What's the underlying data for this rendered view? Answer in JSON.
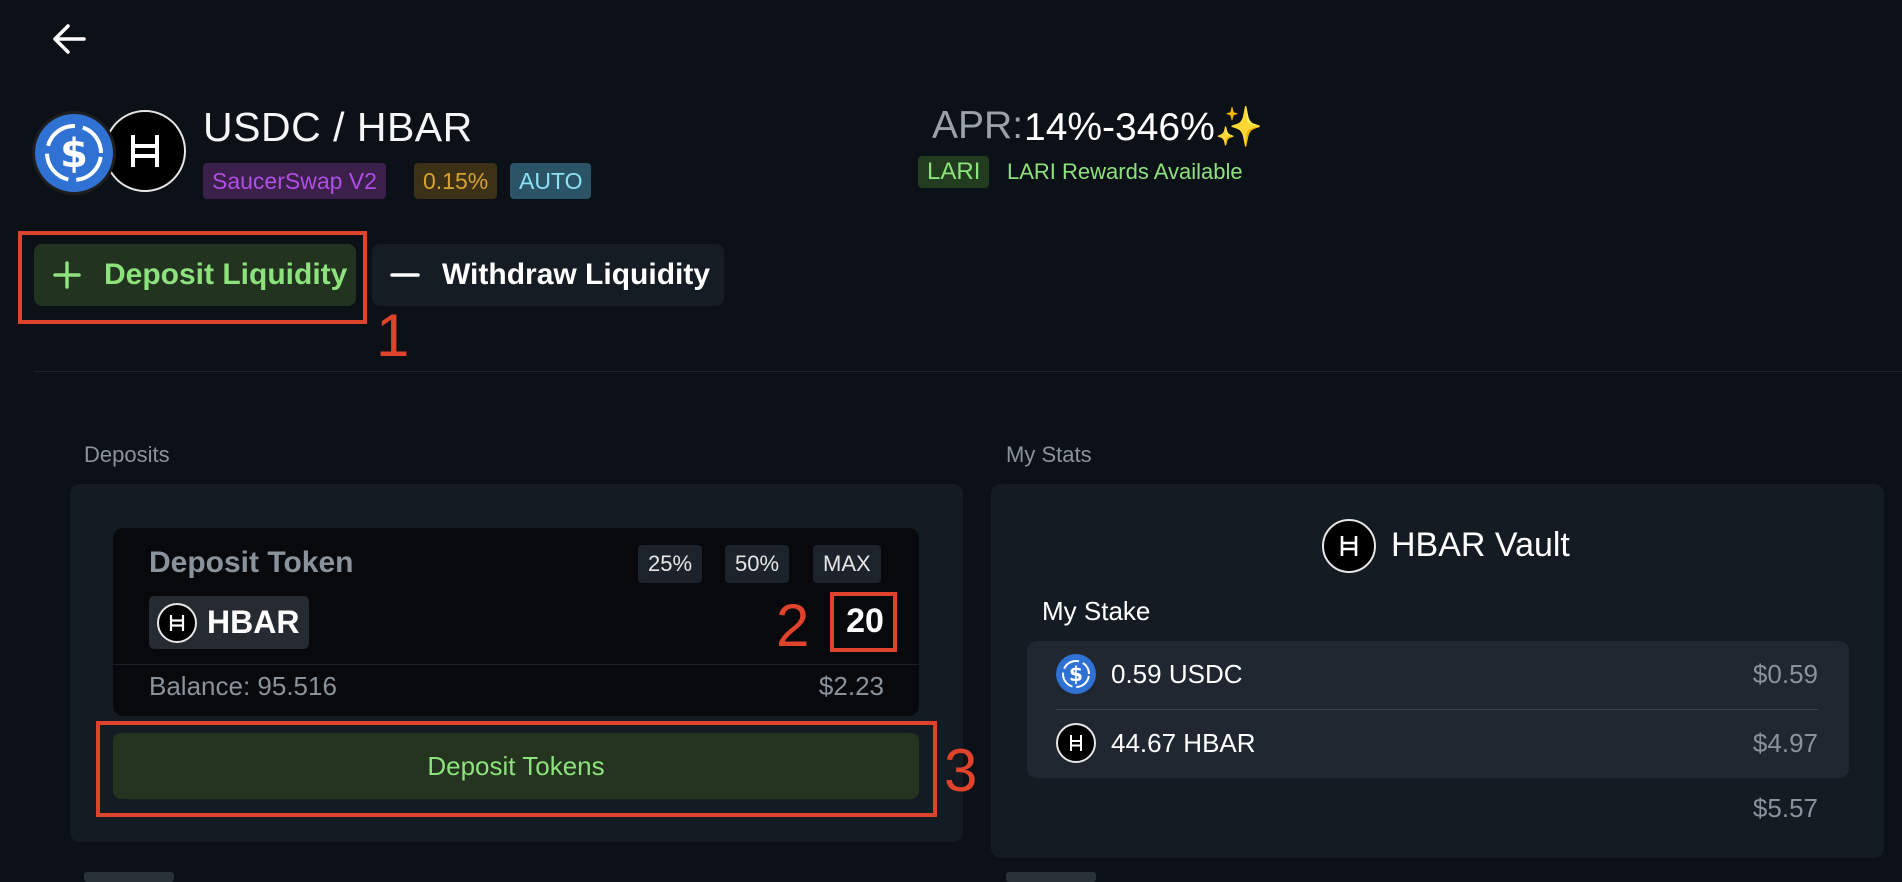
{
  "header": {
    "pair_title": "USDC / HBAR",
    "badges": {
      "dex": "SaucerSwap V2",
      "fee": "0.15%",
      "mode": "AUTO"
    },
    "apr": {
      "label": "APR:",
      "value": "14%-346%✨"
    },
    "rewards": {
      "badge": "LARI",
      "text": "LARI Rewards Available"
    }
  },
  "actions": {
    "deposit_label": "Deposit Liquidity",
    "withdraw_label": "Withdraw Liquidity"
  },
  "annotations": {
    "one": "1",
    "two": "2",
    "three": "3"
  },
  "deposits": {
    "section_label": "Deposits",
    "card_title": "Deposit Token",
    "pct_buttons": [
      "25%",
      "50%",
      "MAX"
    ],
    "token": "HBAR",
    "amount": "20",
    "balance": "Balance: 95.516",
    "usd_value": "$2.23",
    "submit_label": "Deposit Tokens"
  },
  "stats": {
    "section_label": "My Stats",
    "vault_title": "HBAR Vault",
    "my_stake_label": "My Stake",
    "rows": [
      {
        "amount": "0.59 USDC",
        "usd": "$0.59",
        "icon": "usdc-icon"
      },
      {
        "amount": "44.67 HBAR",
        "usd": "$4.97",
        "icon": "hbar-icon"
      }
    ],
    "total": "$5.57"
  },
  "colors": {
    "background": "#0c1118",
    "accent_green": "#8de27d",
    "annotation_red": "#e0432b",
    "usdc_blue": "#2f72d3"
  }
}
